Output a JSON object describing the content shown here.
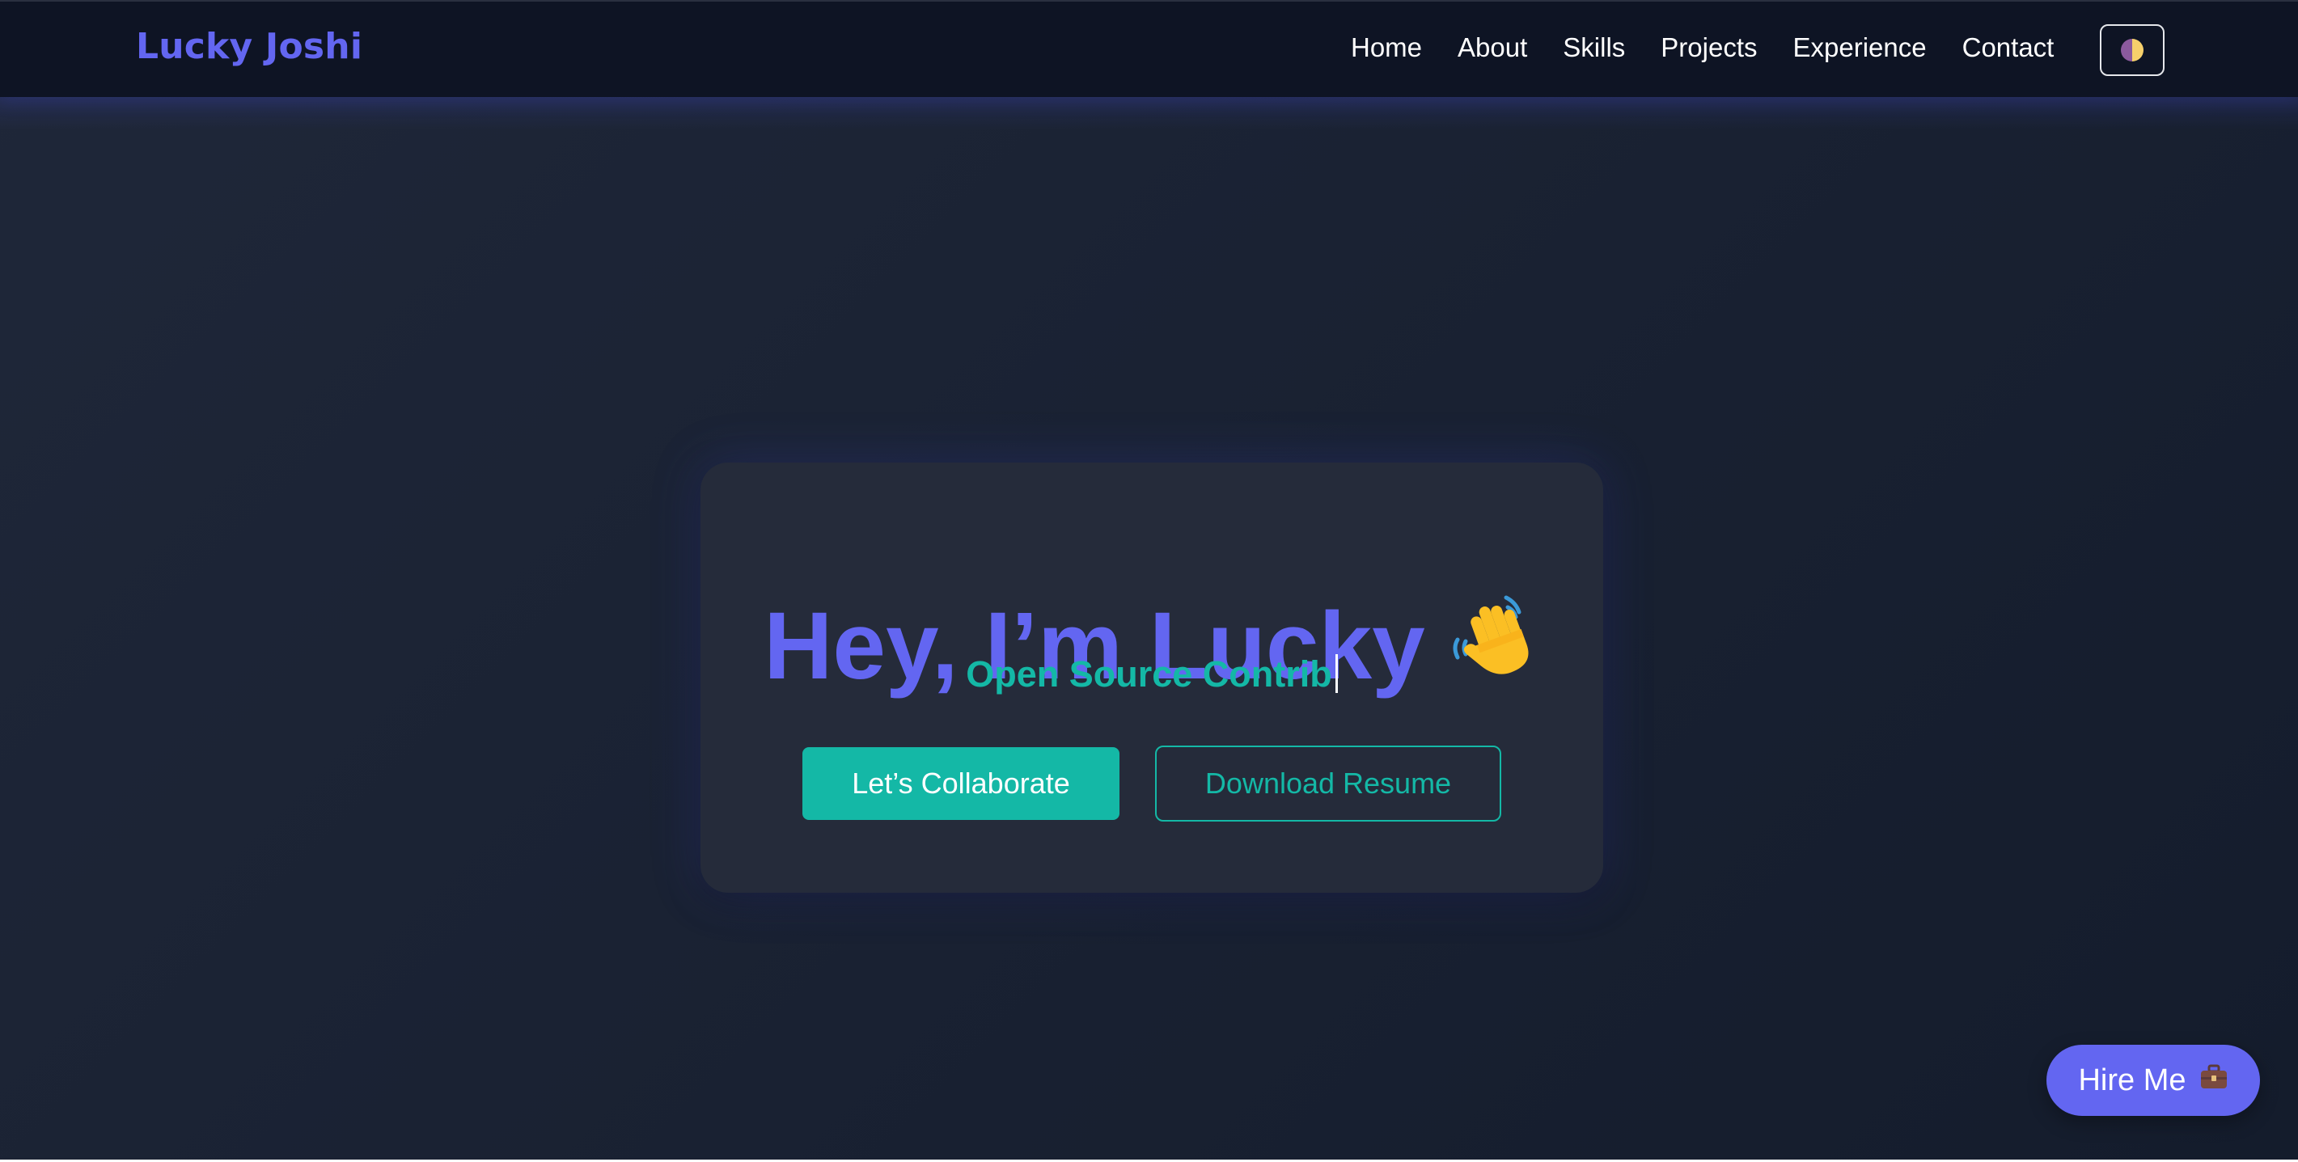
{
  "navbar": {
    "brand": "Lucky Joshi",
    "links": [
      "Home",
      "About",
      "Skills",
      "Projects",
      "Experience",
      "Contact"
    ],
    "theme_toggle_icon": "half-moon-icon"
  },
  "hero": {
    "title": "Hey, I’m Lucky",
    "title_icon": "waving-hand-icon",
    "typing_text": "Open Source Contrib",
    "primary_button": "Let’s Collaborate",
    "secondary_button": "Download Resume"
  },
  "floating": {
    "hire_label": "Hire Me",
    "hire_icon": "briefcase-icon"
  },
  "colors": {
    "brand": "#6366f1",
    "accent": "#14b8a6",
    "background": "#1a2233",
    "navbar": "#0e1424",
    "card": "#252b3a"
  }
}
